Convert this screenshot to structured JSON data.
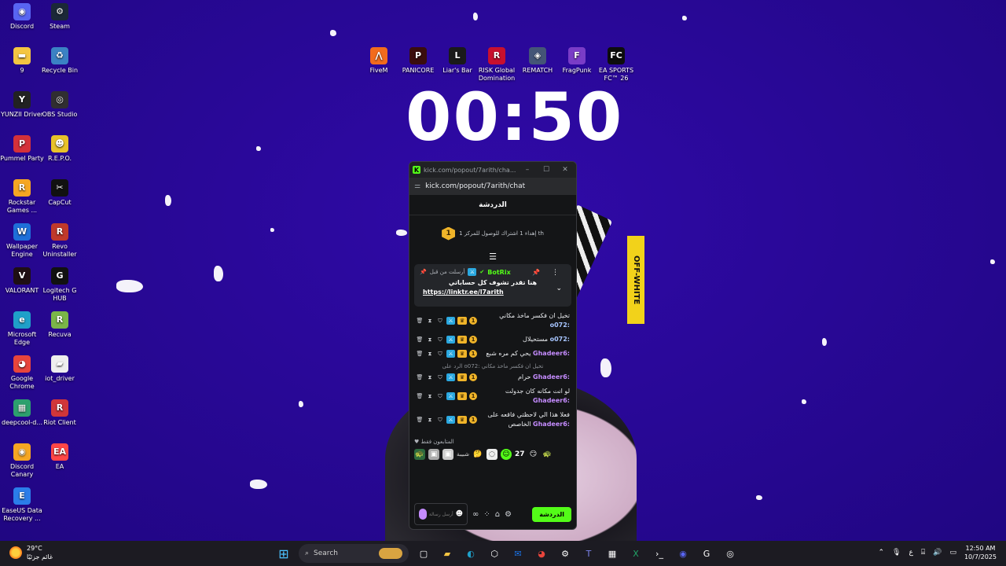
{
  "desktop": {
    "left_icons": [
      {
        "label": "Discord",
        "icon": "discord-icon",
        "color": "#5865f2",
        "glyph": "◉"
      },
      {
        "label": "Steam",
        "icon": "steam-icon",
        "color": "#1b2838",
        "glyph": "⚙"
      },
      {
        "label": "9",
        "icon": "folder-icon",
        "color": "#f4c542",
        "glyph": "▬"
      },
      {
        "label": "Recycle Bin",
        "icon": "recycle-bin-icon",
        "color": "#3b82c4",
        "glyph": "♻"
      },
      {
        "label": "YUNZII Driver",
        "icon": "yunzii-icon",
        "color": "#222222",
        "glyph": "Y"
      },
      {
        "label": "OBS Studio",
        "icon": "obs-icon",
        "color": "#302e31",
        "glyph": "◎"
      },
      {
        "label": "Pummel Party",
        "icon": "pummel-party-icon",
        "color": "#d4313a",
        "glyph": "P"
      },
      {
        "label": "R.E.P.O.",
        "icon": "repo-icon",
        "color": "#e8c22a",
        "glyph": "☻"
      },
      {
        "label": "Rockstar Games ...",
        "icon": "rockstar-icon",
        "color": "#f5a623",
        "glyph": "R"
      },
      {
        "label": "CapCut",
        "icon": "capcut-icon",
        "color": "#111111",
        "glyph": "✂"
      },
      {
        "label": "Wallpaper Engine",
        "icon": "wallpaper-engine-icon",
        "color": "#1e6fd9",
        "glyph": "W"
      },
      {
        "label": "Revo Uninstaller",
        "icon": "revo-icon",
        "color": "#c0392b",
        "glyph": "R"
      },
      {
        "label": "VALORANT",
        "icon": "valorant-icon",
        "color": "#1f0f14",
        "glyph": "V"
      },
      {
        "label": "Logitech G HUB",
        "icon": "logitech-icon",
        "color": "#111111",
        "glyph": "G"
      },
      {
        "label": "Microsoft Edge",
        "icon": "edge-icon",
        "color": "#1fa0c9",
        "glyph": "e"
      },
      {
        "label": "Recuva",
        "icon": "recuva-icon",
        "color": "#7ab648",
        "glyph": "R"
      },
      {
        "label": "Google Chrome",
        "icon": "chrome-icon",
        "color": "#e8453c",
        "glyph": "◕"
      },
      {
        "label": "iot_driver",
        "icon": "iot-driver-icon",
        "color": "#eeeeee",
        "glyph": "▰"
      },
      {
        "label": "deepcool-d...",
        "icon": "deepcool-icon",
        "color": "#2da06e",
        "glyph": "▦"
      },
      {
        "label": "Riot Client",
        "icon": "riot-icon",
        "color": "#d13639",
        "glyph": "R"
      },
      {
        "label": "Discord Canary",
        "icon": "discord-canary-icon",
        "color": "#f5a623",
        "glyph": "◉"
      },
      {
        "label": "EA",
        "icon": "ea-icon",
        "color": "#ff4747",
        "glyph": "EA"
      },
      {
        "label": "EaseUS Data Recovery ...",
        "icon": "easeus-icon",
        "color": "#2b7de9",
        "glyph": "E"
      }
    ],
    "top_icons": [
      {
        "label": "FiveM",
        "icon": "fivem-icon",
        "color": "#f26b1d",
        "glyph": "⋀"
      },
      {
        "label": "PANICORE",
        "icon": "panicore-icon",
        "color": "#3a0d0d",
        "glyph": "P"
      },
      {
        "label": "Liar's Bar",
        "icon": "liars-bar-icon",
        "color": "#1a1a1a",
        "glyph": "L"
      },
      {
        "label": "RISK Global Domination",
        "icon": "risk-icon",
        "color": "#c8102e",
        "glyph": "R"
      },
      {
        "label": "REMATCH",
        "icon": "rematch-icon",
        "color": "#445577",
        "glyph": "◈"
      },
      {
        "label": "FragPunk",
        "icon": "fragpunk-icon",
        "color": "#7a3cc7",
        "glyph": "F"
      },
      {
        "label": "EA SPORTS FC™ 26",
        "icon": "ea-fc-icon",
        "color": "#0d0d0d",
        "glyph": "FC"
      }
    ],
    "clock": "00:50"
  },
  "popup": {
    "title": "kick.com/popout/7arith/cha...",
    "url": "kick.com/popout/7arith/chat",
    "header": "الدردشة",
    "goal_text": "إهداء 1 اشتراك للوصول للمركز 1 th",
    "goal_rank": "1",
    "pinned": {
      "sent_by": "أرسلت من قبل",
      "bot": "BotRix",
      "message": "هنا تقدر تشوف كل حساباتي",
      "link": "https://linktr.ee/l7arith"
    },
    "messages": [
      {
        "user": "o072:",
        "text": "تخيل ان فكسر ماخذ مكاني",
        "cls": "o"
      },
      {
        "user": "o072:",
        "text": "مستحيلال",
        "cls": "o"
      },
      {
        "user": "Ghadeer6:",
        "text": "يحي كم مره شبع",
        "cls": "g"
      },
      {
        "user": "Ghadeer6:",
        "text": "حرام",
        "cls": "g",
        "reply": "الرد على o072: تخيل ان فكسر ماخذ مكاني"
      },
      {
        "user": "Ghadeer6:",
        "text": "لو انت مكانه كان جدولت",
        "cls": "g"
      },
      {
        "user": "Ghadeer6:",
        "text": "فعلا هذا الي لاحظتي فاقعه على الخاصص",
        "cls": "g"
      }
    ],
    "subs_label": "المتابعون فقط",
    "emote_count": "27",
    "emote_text": "شبيبة",
    "input_placeholder": "أرسل رسالة",
    "send_label": "الدردشة"
  },
  "taskbar": {
    "weather_temp": "29°C",
    "weather_desc": "غائم جزئيًا",
    "search_label": "Search",
    "lang": "ع",
    "time": "12:50 AM",
    "date": "10/7/2025"
  },
  "colors": {
    "kick_green": "#53fc18",
    "wallpaper": "#2c0a9e"
  }
}
